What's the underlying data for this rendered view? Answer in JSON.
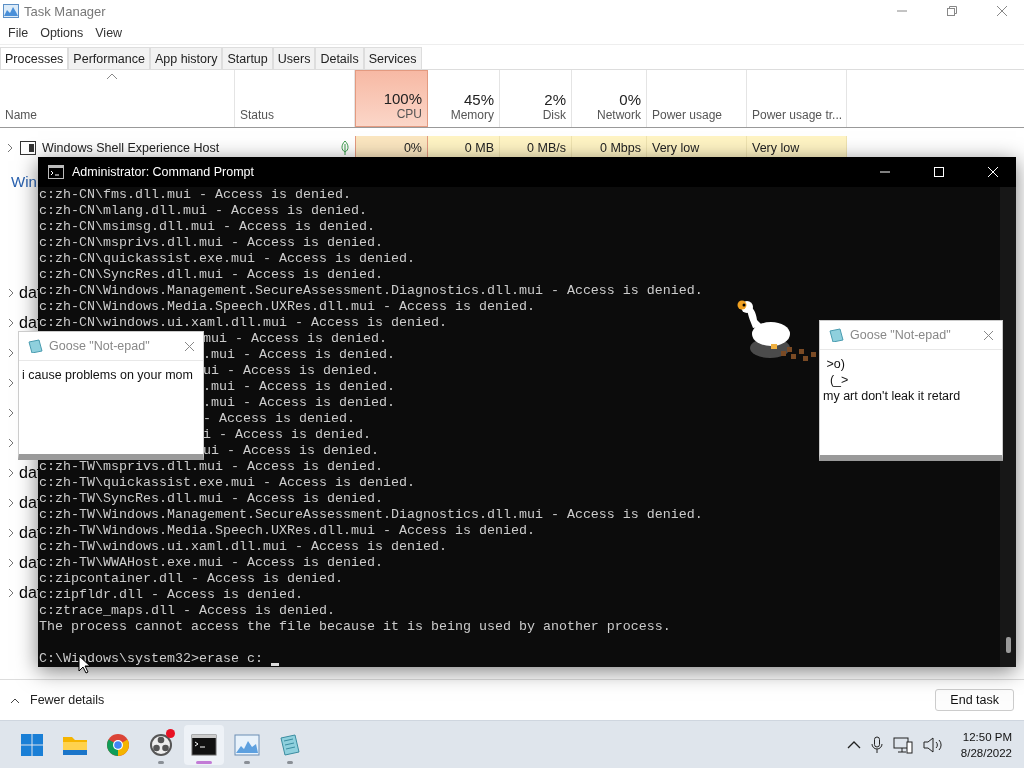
{
  "task_manager": {
    "title": "Task Manager",
    "menu": [
      "File",
      "Options",
      "View"
    ],
    "tabs": [
      {
        "label": "Processes",
        "selected": true
      },
      {
        "label": "Performance",
        "selected": false
      },
      {
        "label": "App history",
        "selected": false
      },
      {
        "label": "Startup",
        "selected": false
      },
      {
        "label": "Users",
        "selected": false
      },
      {
        "label": "Details",
        "selected": false
      },
      {
        "label": "Services",
        "selected": false
      }
    ],
    "columns": [
      {
        "kind": "name",
        "label": "Name",
        "sorted": true,
        "highlighted": false
      },
      {
        "kind": "status",
        "label": "Status",
        "sorted": false,
        "highlighted": false
      },
      {
        "kind": "metric",
        "reading": "100%",
        "label": "CPU",
        "sorted": false,
        "highlighted": true
      },
      {
        "kind": "metric",
        "reading": "45%",
        "label": "Memory",
        "sorted": false,
        "highlighted": false
      },
      {
        "kind": "metric",
        "reading": "2%",
        "label": "Disk",
        "sorted": false,
        "highlighted": false
      },
      {
        "kind": "metric",
        "reading": "0%",
        "label": "Network",
        "sorted": false,
        "highlighted": false
      },
      {
        "kind": "text",
        "label": "Power usage",
        "sorted": false,
        "highlighted": false
      },
      {
        "kind": "text",
        "label": "Power usage tr...",
        "sorted": false,
        "highlighted": false
      }
    ],
    "rows": [
      {
        "name": "Windows Shell Experience Host",
        "values": [
          "0%",
          "0 MB",
          "0 MB/s",
          "0 Mbps",
          "Very low",
          "Very low"
        ]
      }
    ],
    "group_heading": "Win",
    "footer": {
      "toggle": "Fewer details",
      "button": "End task"
    }
  },
  "command_prompt": {
    "title": "Administrator: Command Prompt",
    "lines": [
      {
        "text": "c:zh-CN\\fms.dll.mui - Access is denied.",
        "covered": false
      },
      {
        "text": "c:zh-CN\\mlang.dll.mui - Access is denied.",
        "covered": false
      },
      {
        "text": "c:zh-CN\\msimsg.dll.mui - Access is denied.",
        "covered": false
      },
      {
        "text": "c:zh-CN\\msprivs.dll.mui - Access is denied.",
        "covered": false
      },
      {
        "text": "c:zh-CN\\quickassist.exe.mui - Access is denied.",
        "covered": false
      },
      {
        "text": "c:zh-CN\\SyncRes.dll.mui - Access is denied.",
        "covered": false
      },
      {
        "text": "c:zh-CN\\Windows.Management.SecureAssessment.Diagnostics.dll.mui - Access is denied.",
        "covered": false
      },
      {
        "text": "c:zh-CN\\Windows.Media.Speech.UXRes.dll.mui - Access is denied.",
        "covered": false
      },
      {
        "text": "c:zh-CN\\windows.ui.xaml.dll.mui - Access is denied.",
        "covered": false
      },
      {
        "text": "mui - Access is denied.",
        "covered": true
      },
      {
        "text": ".mui - Access is denied.",
        "covered": true
      },
      {
        "text": "ui - Access is denied.",
        "covered": true
      },
      {
        "text": ".mui - Access is denied.",
        "covered": true
      },
      {
        "text": ".mui - Access is denied.",
        "covered": true
      },
      {
        "text": "- Access is denied.",
        "covered": true
      },
      {
        "text": "i - Access is denied.",
        "covered": true
      },
      {
        "text": "ui - Access is denied.",
        "covered": true
      },
      {
        "text": "c:zh-TW\\msprivs.dll.mui - Access is denied.",
        "covered": false
      },
      {
        "text": "c:zh-TW\\quickassist.exe.mui - Access is denied.",
        "covered": false
      },
      {
        "text": "c:zh-TW\\SyncRes.dll.mui - Access is denied.",
        "covered": false
      },
      {
        "text": "c:zh-TW\\Windows.Management.SecureAssessment.Diagnostics.dll.mui - Access is denied.",
        "covered": false
      },
      {
        "text": "c:zh-TW\\Windows.Media.Speech.UXRes.dll.mui - Access is denied.",
        "covered": false
      },
      {
        "text": "c:zh-TW\\windows.ui.xaml.dll.mui - Access is denied.",
        "covered": false
      },
      {
        "text": "c:zh-TW\\WWAHost.exe.mui - Access is denied.",
        "covered": false
      },
      {
        "text": "c:zipcontainer.dll - Access is denied.",
        "covered": false
      },
      {
        "text": "c:zipfldr.dll - Access is denied.",
        "covered": false
      },
      {
        "text": "c:ztrace_maps.dll - Access is denied.",
        "covered": false
      },
      {
        "text": "The process cannot access the file because it is being used by another process.",
        "covered": false
      }
    ],
    "prompt": "C:\\Windows\\system32>erase c:"
  },
  "notes": [
    {
      "title": "Goose \"Not-epad\"",
      "text": "i cause problems on your mom"
    },
    {
      "title": "Goose \"Not-epad\"",
      "text": " >o)\n  (_>\nmy art don't leak it retard"
    }
  ],
  "taskbar": {
    "apps": [
      {
        "kind": "start",
        "running": false,
        "active": false,
        "badge": false
      },
      {
        "kind": "explorer",
        "running": false,
        "active": false,
        "badge": false
      },
      {
        "kind": "chrome",
        "running": false,
        "active": false,
        "badge": false
      },
      {
        "kind": "obs",
        "running": true,
        "active": false,
        "badge": true
      },
      {
        "kind": "terminal",
        "running": true,
        "active": true,
        "badge": false
      },
      {
        "kind": "monitor",
        "running": true,
        "active": false,
        "badge": false
      },
      {
        "kind": "notepad",
        "running": true,
        "active": false,
        "badge": false
      }
    ],
    "time": "12:50 PM",
    "date": "8/28/2022"
  }
}
